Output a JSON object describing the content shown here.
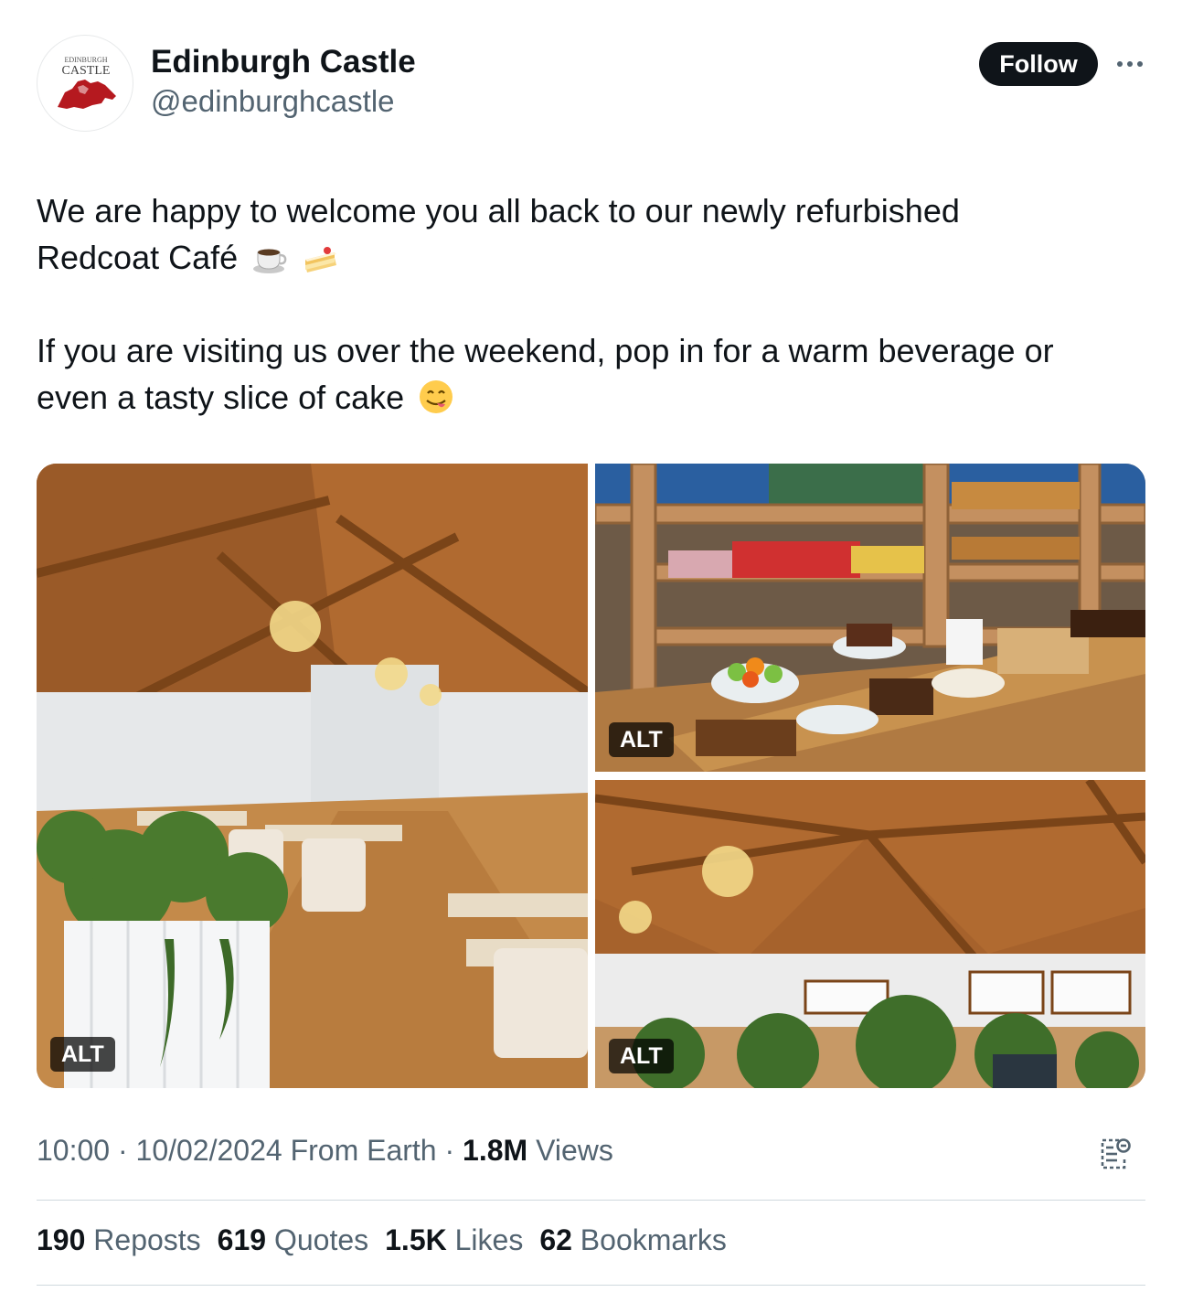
{
  "account": {
    "name": "Edinburgh Castle",
    "handle": "@edinburghcastle",
    "avatar_small_text": "EDINBURGH",
    "avatar_big_text": "CASTLE"
  },
  "follow_label": "Follow",
  "tweet": {
    "line1": "We are happy to welcome you all back to our newly refurbished",
    "line2": "Redcoat Café",
    "line3": "If you are visiting us over the weekend, pop in for a warm beverage or",
    "line4": "even a tasty slice of cake",
    "emojis": [
      "coffee-icon",
      "cake-icon",
      "yum-face-icon"
    ]
  },
  "media": {
    "alt_label": "ALT"
  },
  "meta": {
    "time": "10:00",
    "sep1": " · ",
    "date": "10/02/2024",
    "source": " From Earth",
    "sep2": " · ",
    "views_count": "1.8M",
    "views_label": " Views"
  },
  "stats": {
    "reposts_count": "190",
    "reposts_label": "Reposts",
    "quotes_count": "619",
    "quotes_label": "Quotes",
    "likes_count": "1.5K",
    "likes_label": "Likes",
    "bookmarks_count": "62",
    "bookmarks_label": "Bookmarks"
  },
  "colors": {
    "text": "#0f1419",
    "secondary": "#536471",
    "divider": "#cfd9de",
    "brand_red": "#b5191f"
  }
}
